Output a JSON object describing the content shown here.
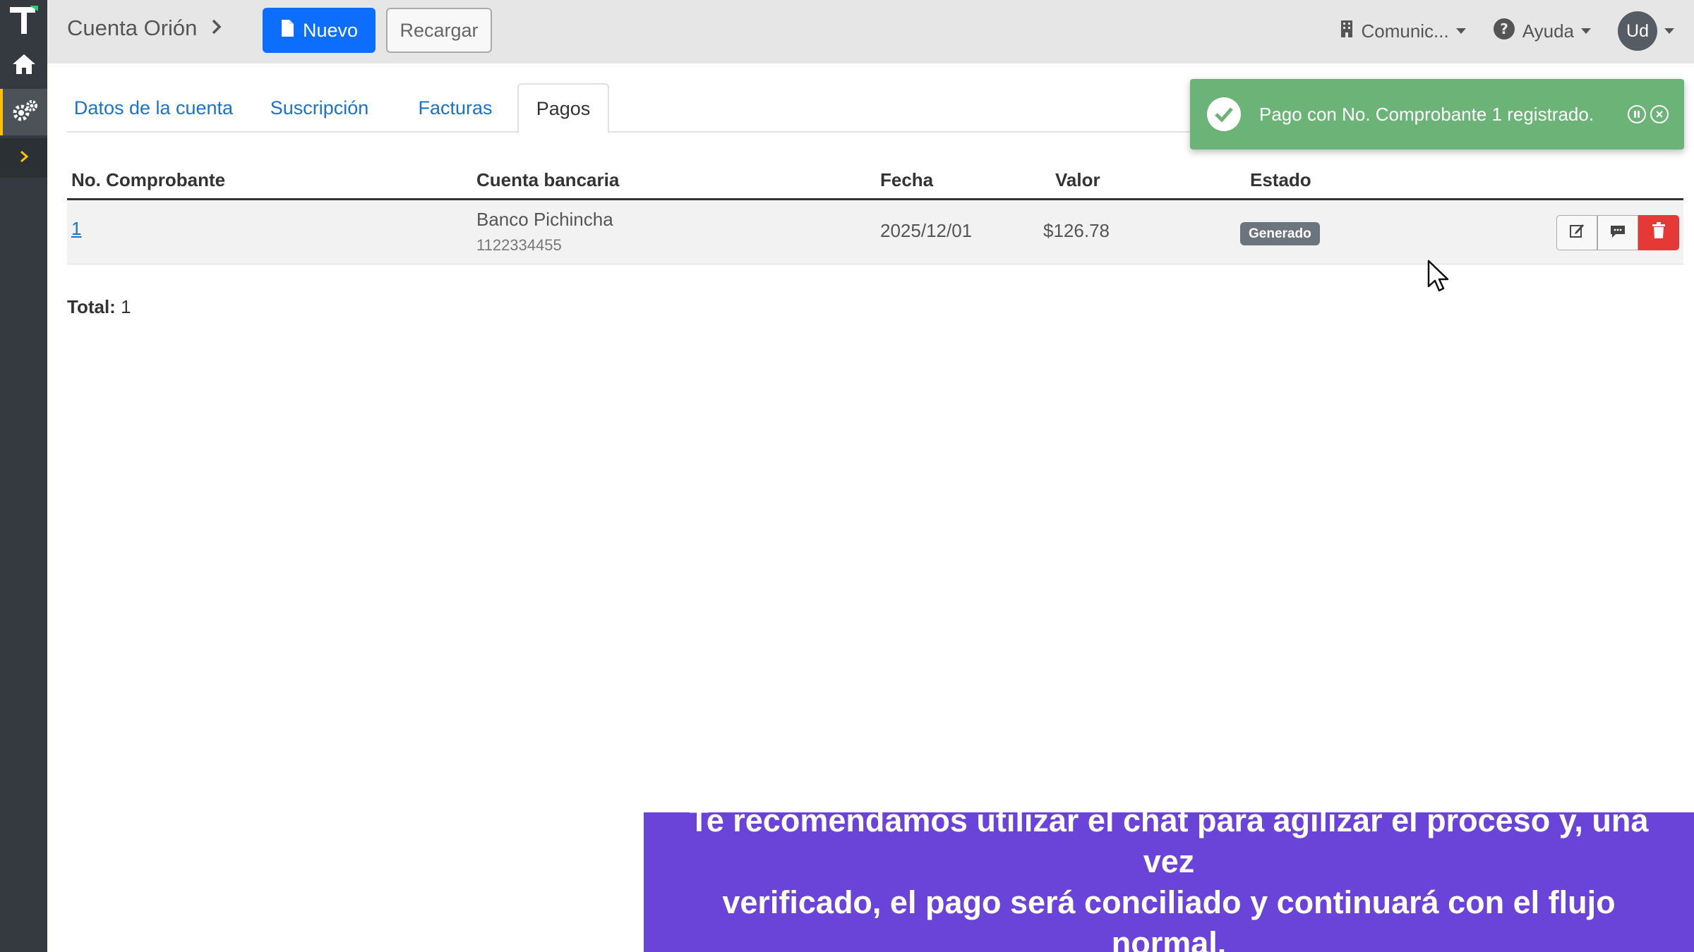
{
  "header": {
    "breadcrumb": "Cuenta Orión",
    "new_label": "Nuevo",
    "reload_label": "Recargar",
    "company_label": "Comunic...",
    "help_label": "Ayuda",
    "user_initials": "Ud"
  },
  "tabs": [
    {
      "label": "Datos de la cuenta",
      "active": false
    },
    {
      "label": "Suscripción",
      "active": false
    },
    {
      "label": "Facturas",
      "active": false
    },
    {
      "label": "Pagos",
      "active": true
    }
  ],
  "table": {
    "columns": [
      "No. Comprobante",
      "Cuenta bancaria",
      "Fecha",
      "Valor",
      "Estado"
    ],
    "rows": [
      {
        "comprobante": "1",
        "bank": "Banco Pichincha",
        "account_number": "1122334455",
        "date": "2025/12/01",
        "amount": "$126.78",
        "status": "Generado"
      }
    ]
  },
  "footer": {
    "total_label": "Total:",
    "total_value": "1"
  },
  "toast": {
    "message": "Pago con No. Comprobante 1 registrado."
  },
  "caption": {
    "line1": "Te recomendamos utilizar el chat para agilizar el proceso y, una vez",
    "line2": "verificado, el pago será conciliado y continuará con el flujo normal."
  },
  "colors": {
    "primary": "#0d6efd",
    "toast_success": "#6bb377",
    "caption_bg": "#6a44d8",
    "delete": "#e53935",
    "sidebar": "#343a40"
  },
  "icons": [
    "logo-icon",
    "home-icon",
    "settings-icon",
    "chevron-right-icon",
    "file-icon",
    "building-icon",
    "help-icon",
    "check-icon",
    "edit-icon",
    "comment-icon",
    "trash-icon",
    "pause-icon",
    "close-icon",
    "cursor-icon"
  ]
}
